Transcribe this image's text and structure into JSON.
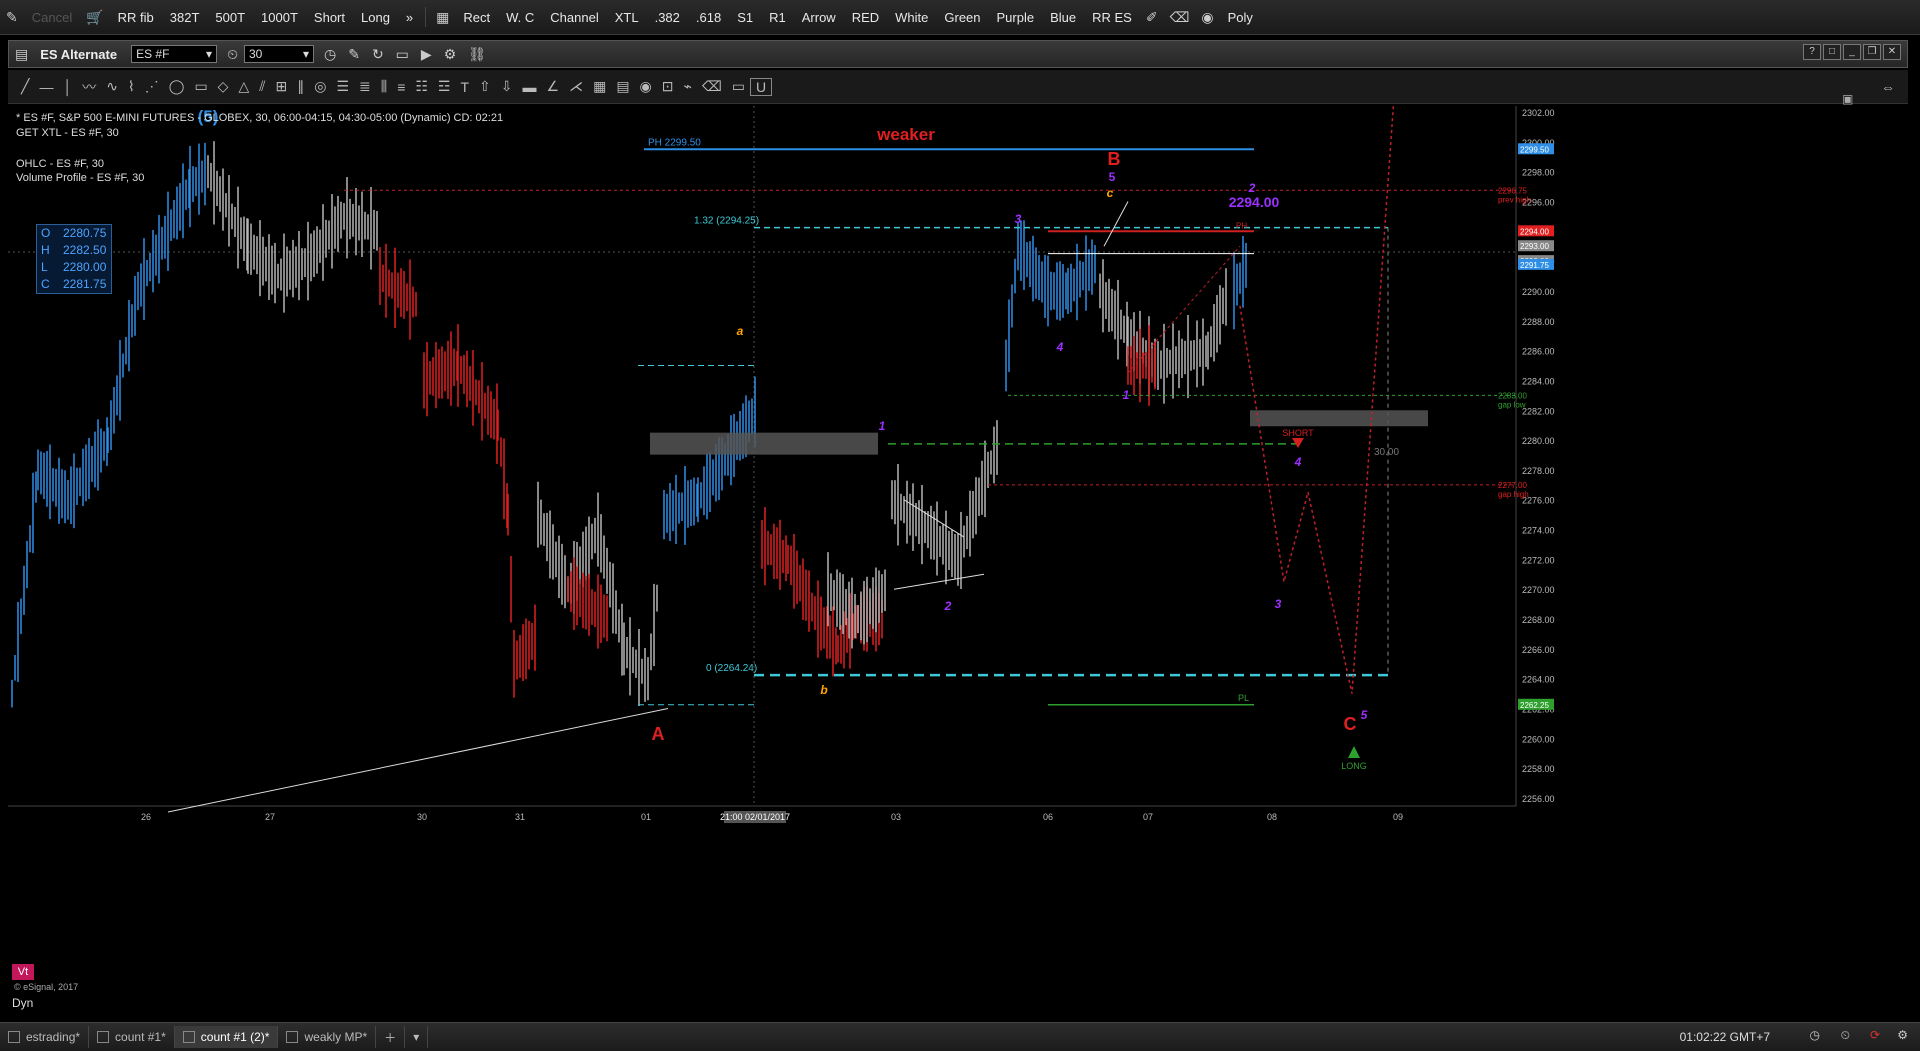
{
  "toolbar": {
    "cancel": "Cancel",
    "items": [
      "RR fib",
      "382T",
      "500T",
      "1000T",
      "Short",
      "Long",
      "»",
      "Rect",
      "W. C",
      "Channel",
      "XTL",
      ".382",
      ".618",
      "S1",
      "R1",
      "Arrow",
      "RED",
      "White",
      "Green",
      "Purple",
      "Blue",
      "RR ES",
      "Poly"
    ]
  },
  "window": {
    "title": "ES Alternate",
    "symbol": "ES #F",
    "interval": "30"
  },
  "chart_info": {
    "line1": "* ES #F, S&P 500 E-MINI FUTURES - GLOBEX, 30, 06:00-04:15, 04:30-05:00 (Dynamic) CD: 02:21",
    "line2": "GET XTL - ES #F, 30",
    "line3": "OHLC - ES #F, 30",
    "line4": "Volume Profile - ES #F, 30"
  },
  "ohlc": {
    "O": "2280.75",
    "H": "2282.50",
    "L": "2280.00",
    "C": "2281.75"
  },
  "annotations": {
    "weaker": "weaker",
    "ph": "PH 2299.50",
    "fib132": "1.32 (2294.25)",
    "fib0": "0 (2264.24)",
    "wave5_top": "(5)",
    "waveA": "A",
    "waveB": "B",
    "waveC": "C",
    "small_a": "a",
    "small_b": "b",
    "small_c": "c",
    "b5": "5",
    "w1": "1",
    "w2": "2",
    "w3": "3",
    "w4": "4",
    "w1b": "1",
    "w2b": "2",
    "w3b": "3",
    "w4b": "4",
    "w5b": "5",
    "price2294": "2294.00",
    "short": "SHORT",
    "long": "LONG",
    "pl": "PL",
    "ph_small": "PH",
    "dist": "30.00",
    "prev_high_val": "2296.75",
    "prev_high": "prev high",
    "gap_low_val": "2283.00",
    "gap_low": "gap low",
    "gap_high_val": "2277.00",
    "gap_high": "gap high",
    "cursor_date": "21:00 02/01/2017"
  },
  "price_axis": [
    "2302.00",
    "2300.00",
    "2298.00",
    "2296.00",
    "2294.00",
    "2292.00",
    "2290.00",
    "2288.00",
    "2286.00",
    "2284.00",
    "2282.00",
    "2280.00",
    "2278.00",
    "2276.00",
    "2274.00",
    "2272.00",
    "2270.00",
    "2268.00",
    "2266.00",
    "2264.00",
    "2262.00",
    "2260.00",
    "2258.00",
    "2256.00"
  ],
  "price_tags": {
    "t1": "2299.50",
    "t2": "2294.00",
    "t3": "2293.00",
    "t4": "2292.00",
    "t5": "2291.75",
    "t6": "2262.25"
  },
  "date_axis": [
    "26",
    "27",
    "30",
    "31",
    "01",
    "03",
    "06",
    "07",
    "08",
    "09"
  ],
  "footer": {
    "vt": "Vt",
    "copyright": "© eSignal, 2017",
    "dyn": "Dyn",
    "tabs": [
      "estrading*",
      "count #1*",
      "count #1 (2)*",
      "weakly MP*"
    ],
    "clock": "01:02:22 GMT+7"
  },
  "colors": {
    "up": "#2f8fe6",
    "down": "#e02020",
    "neutral": "#b5b5b5",
    "purple": "#9b30ff",
    "orange": "#ffa500"
  }
}
